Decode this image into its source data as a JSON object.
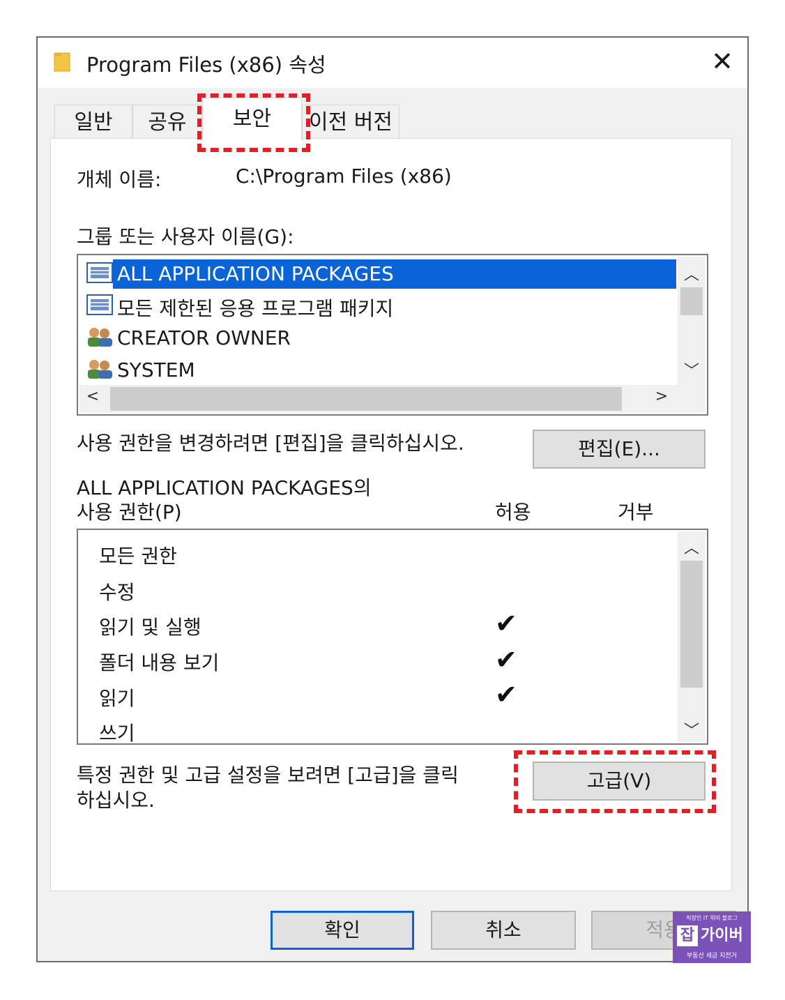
{
  "window": {
    "title": "Program Files (x86) 속성",
    "close_glyph": "✕"
  },
  "tabs": [
    {
      "label": "일반"
    },
    {
      "label": "공유"
    },
    {
      "label": "보안"
    },
    {
      "label": "이전 버전"
    }
  ],
  "object_name": {
    "label": "개체 이름:",
    "value": "C:\\Program Files (x86)"
  },
  "groups": {
    "label": "그룹 또는 사용자 이름(G):",
    "items": [
      {
        "name": "ALL APPLICATION PACKAGES",
        "icon": "package-icon",
        "selected": true
      },
      {
        "name": "모든 제한된 응용 프로그램 패키지",
        "icon": "package-icon",
        "selected": false
      },
      {
        "name": "CREATOR OWNER",
        "icon": "users-icon",
        "selected": false
      },
      {
        "name": "SYSTEM",
        "icon": "users-icon",
        "selected": false
      }
    ]
  },
  "edit": {
    "hint": "사용 권한을 변경하려면 [편집]을 클릭하십시오.",
    "button": "편집(E)..."
  },
  "permissions": {
    "title_line1": "ALL APPLICATION PACKAGES의",
    "title_line2": "사용 권한(P)",
    "allow_header": "허용",
    "deny_header": "거부",
    "check_glyph": "✔",
    "rows": [
      {
        "name": "모든 권한",
        "allow": false,
        "deny": false
      },
      {
        "name": "수정",
        "allow": false,
        "deny": false
      },
      {
        "name": "읽기 및 실행",
        "allow": true,
        "deny": false
      },
      {
        "name": "폴더 내용 보기",
        "allow": true,
        "deny": false
      },
      {
        "name": "읽기",
        "allow": true,
        "deny": false
      },
      {
        "name": "쓰기",
        "allow": false,
        "deny": false
      }
    ]
  },
  "advanced": {
    "hint_line1": "특정 권한 및 고급 설정을 보려면 [고급]을 클릭",
    "hint_line2": "하십시오.",
    "button": "고급(V)"
  },
  "footer": {
    "ok": "확인",
    "cancel": "취소",
    "apply": "적용"
  },
  "watermark": {
    "top": "직장인 IT 위미 블로그",
    "main_1": "잡",
    "main_2": "가이버",
    "bottom": "부동산 세금 지전거"
  },
  "colors": {
    "selection": "#0a64d8",
    "highlight_dash": "#e41e26",
    "watermark_bg": "#7b52b8"
  }
}
